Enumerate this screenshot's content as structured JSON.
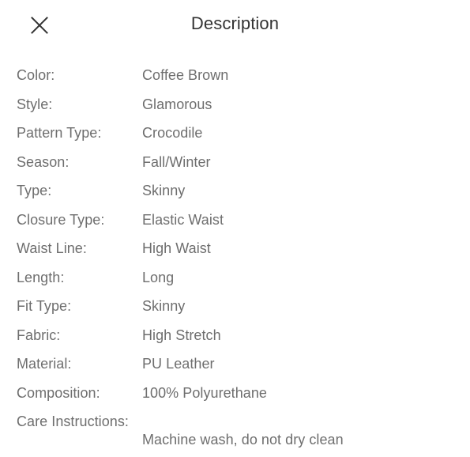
{
  "header": {
    "title": "Description",
    "close_icon": "close-icon"
  },
  "specs": [
    {
      "label": "Color:",
      "value": "Coffee Brown"
    },
    {
      "label": "Style:",
      "value": "Glamorous"
    },
    {
      "label": "Pattern Type:",
      "value": "Crocodile"
    },
    {
      "label": "Season:",
      "value": "Fall/Winter"
    },
    {
      "label": "Type:",
      "value": "Skinny"
    },
    {
      "label": "Closure Type:",
      "value": "Elastic Waist"
    },
    {
      "label": "Waist Line:",
      "value": "High Waist"
    },
    {
      "label": "Length:",
      "value": "Long"
    },
    {
      "label": "Fit Type:",
      "value": "Skinny"
    },
    {
      "label": "Fabric:",
      "value": "High Stretch"
    },
    {
      "label": "Material:",
      "value": "PU Leather"
    },
    {
      "label": "Composition:",
      "value": "100% Polyurethane"
    },
    {
      "label": "Care Instructions:",
      "value": "Machine wash, do not dry clean"
    }
  ],
  "colors": {
    "background": "#ffffff",
    "title_text": "#333333",
    "body_text": "#6e6e6e",
    "icon": "#333333"
  }
}
